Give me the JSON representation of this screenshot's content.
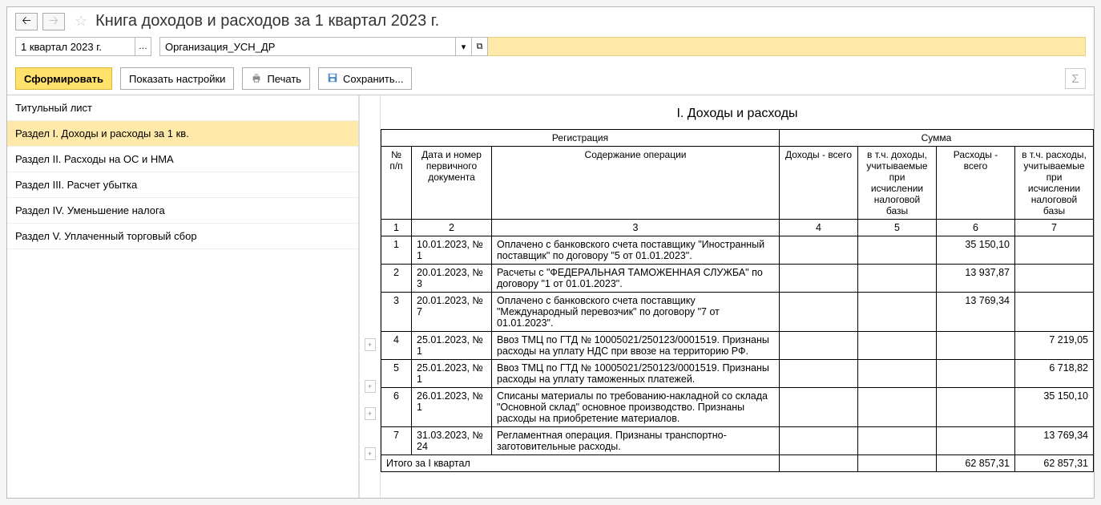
{
  "header": {
    "title": "Книга доходов и расходов за 1 квартал 2023 г."
  },
  "filters": {
    "period_value": "1 квартал 2023 г.",
    "org_value": "Организация_УСН_ДР"
  },
  "toolbar": {
    "generate": "Сформировать",
    "show_settings": "Показать настройки",
    "print": "Печать",
    "save": "Сохранить..."
  },
  "sidebar": {
    "items": [
      "Титульный лист",
      "Раздел I. Доходы и расходы за 1 кв.",
      "Раздел II. Расходы на ОС и НМА",
      "Раздел III. Расчет убытка",
      "Раздел IV. Уменьшение налога",
      "Раздел V. Уплаченный торговый сбор"
    ],
    "active_index": 1
  },
  "report": {
    "title": "I. Доходы и расходы",
    "header_groups": {
      "registration": "Регистрация",
      "sum": "Сумма"
    },
    "columns": {
      "num": "№ п/п",
      "doc": "Дата и номер первичного документа",
      "desc": "Содержание операции",
      "income_total": "Доходы - всего",
      "income_tax": "в т.ч. доходы, учитываемые при исчислении налоговой базы",
      "expense_total": "Расходы - всего",
      "expense_tax": "в т.ч. расходы, учитываемые при исчислении налоговой базы"
    },
    "index_row": [
      "1",
      "2",
      "3",
      "4",
      "5",
      "6",
      "7"
    ],
    "rows": [
      {
        "n": "1",
        "doc": "10.01.2023, № 1",
        "desc": "Оплачено с банковского счета поставщику \"Иностранный поставщик\" по договору \"5 от 01.01.2023\".",
        "c4": "",
        "c5": "",
        "c6": "35 150,10",
        "c7": ""
      },
      {
        "n": "2",
        "doc": "20.01.2023, № 3",
        "desc": "Расчеты с \"ФЕДЕРАЛЬНАЯ ТАМОЖЕННАЯ СЛУЖБА\" по договору \"1 от 01.01.2023\".",
        "c4": "",
        "c5": "",
        "c6": "13 937,87",
        "c7": ""
      },
      {
        "n": "3",
        "doc": "20.01.2023, № 7",
        "desc": "Оплачено с банковского счета поставщику \"Международный перевозчик\" по договору \"7 от 01.01.2023\".",
        "c4": "",
        "c5": "",
        "c6": "13 769,34",
        "c7": ""
      },
      {
        "n": "4",
        "doc": "25.01.2023, № 1",
        "desc": "Ввоз ТМЦ по ГТД № 10005021/250123/0001519. Признаны расходы на уплату НДС при ввозе на территорию РФ.",
        "c4": "",
        "c5": "",
        "c6": "",
        "c7": "7 219,05"
      },
      {
        "n": "5",
        "doc": "25.01.2023, № 1",
        "desc": "Ввоз ТМЦ по ГТД № 10005021/250123/0001519. Признаны расходы на уплату таможенных платежей.",
        "c4": "",
        "c5": "",
        "c6": "",
        "c7": "6 718,82"
      },
      {
        "n": "6",
        "doc": "26.01.2023, № 1",
        "desc": "Списаны материалы по требованию-накладной со склада \"Основной склад\" основное производство. Признаны расходы на приобретение материалов.",
        "c4": "",
        "c5": "",
        "c6": "",
        "c7": "35 150,10"
      },
      {
        "n": "7",
        "doc": "31.03.2023, № 24",
        "desc": "Регламентная операция. Признаны транспортно-заготовительные расходы.",
        "c4": "",
        "c5": "",
        "c6": "",
        "c7": "13 769,34"
      }
    ],
    "total": {
      "label": "Итого за I квартал",
      "c4": "",
      "c5": "",
      "c6": "62 857,31",
      "c7": "62 857,31"
    }
  }
}
